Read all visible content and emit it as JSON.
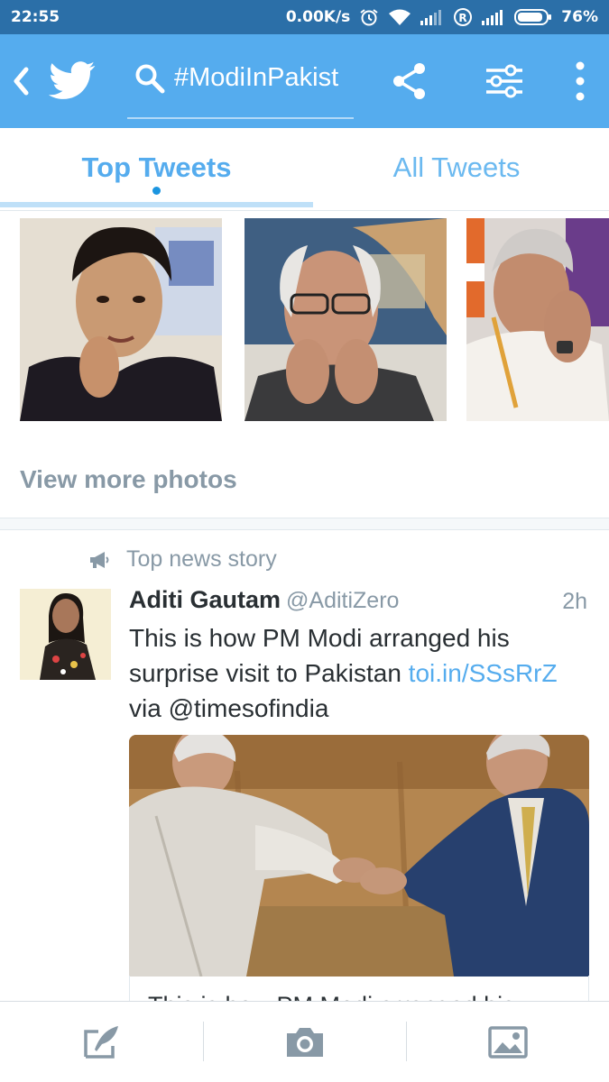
{
  "status_bar": {
    "time": "22:55",
    "net_speed": "0.00K/s",
    "battery": "76%"
  },
  "app_bar": {
    "search_query": "#ModiInPakist"
  },
  "tabs": [
    {
      "label": "Top Tweets",
      "selected": true
    },
    {
      "label": "All Tweets",
      "selected": false
    }
  ],
  "photos": {
    "view_more_label": "View more photos"
  },
  "tweet": {
    "context_label": "Top news story",
    "author_name": "Aditi Gautam",
    "author_handle": "@AditiZero",
    "time": "2h",
    "text_before_link": "This is how PM Modi arranged his surprise visit to Pakistan ",
    "link_text": "toi.in/SSsRrZ",
    "text_after_link": "via @timesofindia",
    "card_text": "This is how PM Modi arranged his"
  },
  "colors": {
    "twitter_blue": "#55acee",
    "status_bar": "#2b6fa8",
    "secondary_text": "#8899a6"
  },
  "icons": {
    "back": "chevron-left-icon",
    "logo": "twitter-bird-icon",
    "search": "search-icon",
    "share": "share-icon",
    "filter": "filter-icon",
    "more": "more-vertical-icon",
    "news": "megaphone-icon",
    "compose": "compose-icon",
    "camera": "camera-icon",
    "gallery": "image-icon"
  }
}
